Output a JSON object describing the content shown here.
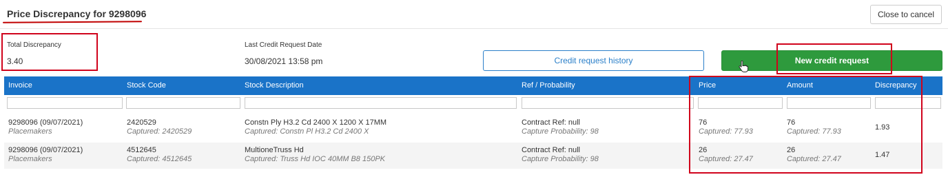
{
  "header": {
    "title": "Price Discrepancy for 9298096",
    "close_label": "Close to cancel"
  },
  "summary": {
    "total_label": "Total Discrepancy",
    "total_value": "3.40",
    "last_date_label": "Last Credit Request Date",
    "last_date_value": "30/08/2021 13:58 pm"
  },
  "actions": {
    "history_label": "Credit request history",
    "new_label": "New credit request"
  },
  "table": {
    "columns": [
      "Invoice",
      "Stock Code",
      "Stock Description",
      "Ref / Probability",
      "Price",
      "Amount",
      "Discrepancy"
    ],
    "rows": [
      {
        "invoice": "9298096 (09/07/2021)",
        "invoice_sub": "Placemakers",
        "stock_code": "2420529",
        "stock_code_sub": "Captured: 2420529",
        "description": "Constn Ply H3.2 Cd 2400 X 1200 X 17MM",
        "description_sub": "Captured: Constn Pl H3.2 Cd 2400 X",
        "ref": "Contract Ref: null",
        "ref_sub": "Capture Probability: 98",
        "price": "76",
        "price_sub": "Captured: 77.93",
        "amount": "76",
        "amount_sub": "Captured: 77.93",
        "discrepancy": "1.93"
      },
      {
        "invoice": "9298096 (09/07/2021)",
        "invoice_sub": "Placemakers",
        "stock_code": "4512645",
        "stock_code_sub": "Captured: 4512645",
        "description": "MultioneTruss Hd",
        "description_sub": "Captured: Truss Hd IOC 40MM B8 150PK",
        "ref": "Contract Ref: null",
        "ref_sub": "Capture Probability: 98",
        "price": "26",
        "price_sub": "Captured: 27.47",
        "amount": "26",
        "amount_sub": "Captured: 27.47",
        "discrepancy": "1.47"
      }
    ]
  },
  "colors": {
    "header_blue": "#1a73c8",
    "button_green": "#2e9a3d",
    "annotation_red": "#d0021b",
    "link_blue": "#2a7fc9"
  }
}
